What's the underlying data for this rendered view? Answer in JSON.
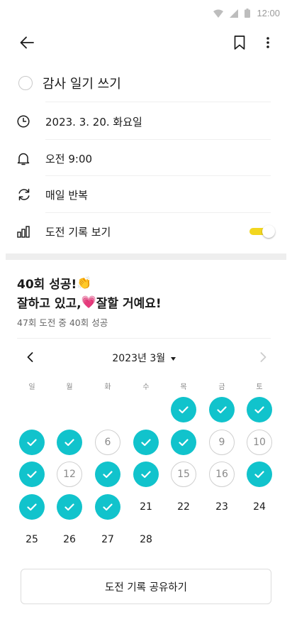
{
  "status_bar": {
    "time": "12:00"
  },
  "task": {
    "title": "감사 일기 쓰기"
  },
  "details": [
    {
      "icon": "clock-icon",
      "label": "2023. 3. 20. 화요일"
    },
    {
      "icon": "bell-icon",
      "label": "오전 9:00"
    },
    {
      "icon": "repeat-icon",
      "label": "매일 반복"
    },
    {
      "icon": "bar-chart-icon",
      "label": "도전 기록 보기"
    }
  ],
  "toggle": {
    "state": "on",
    "accent": "#f2d61f"
  },
  "summary": {
    "line1": "40회 성공!",
    "line1_emoji": "👏",
    "line2a": "잘하고 있고,",
    "line2_emoji": "💗",
    "line2b": " 잘할 거예요!",
    "sub": "47회 도전 중 40회 성공"
  },
  "calendar": {
    "month_label": "2023년 3월",
    "weekdays": [
      "일",
      "월",
      "화",
      "수",
      "목",
      "금",
      "토"
    ],
    "done_color": "#11c3cc",
    "cells": [
      {
        "col": 4,
        "row": 0,
        "day": "",
        "state": "done"
      },
      {
        "col": 5,
        "row": 0,
        "day": "",
        "state": "done"
      },
      {
        "col": 6,
        "row": 0,
        "day": "",
        "state": "done"
      },
      {
        "col": 0,
        "row": 1,
        "day": "",
        "state": "done"
      },
      {
        "col": 1,
        "row": 1,
        "day": "",
        "state": "done"
      },
      {
        "col": 2,
        "row": 1,
        "day": "6",
        "state": "missed"
      },
      {
        "col": 3,
        "row": 1,
        "day": "",
        "state": "done"
      },
      {
        "col": 4,
        "row": 1,
        "day": "",
        "state": "done"
      },
      {
        "col": 5,
        "row": 1,
        "day": "9",
        "state": "missed"
      },
      {
        "col": 6,
        "row": 1,
        "day": "10",
        "state": "missed"
      },
      {
        "col": 0,
        "row": 2,
        "day": "",
        "state": "done"
      },
      {
        "col": 1,
        "row": 2,
        "day": "12",
        "state": "missed"
      },
      {
        "col": 2,
        "row": 2,
        "day": "",
        "state": "done"
      },
      {
        "col": 3,
        "row": 2,
        "day": "",
        "state": "done"
      },
      {
        "col": 4,
        "row": 2,
        "day": "15",
        "state": "missed"
      },
      {
        "col": 5,
        "row": 2,
        "day": "16",
        "state": "missed"
      },
      {
        "col": 6,
        "row": 2,
        "day": "",
        "state": "done"
      },
      {
        "col": 0,
        "row": 3,
        "day": "",
        "state": "done"
      },
      {
        "col": 1,
        "row": 3,
        "day": "",
        "state": "done"
      },
      {
        "col": 2,
        "row": 3,
        "day": "",
        "state": "done"
      },
      {
        "col": 3,
        "row": 3,
        "day": "21",
        "state": "future"
      },
      {
        "col": 4,
        "row": 3,
        "day": "22",
        "state": "future"
      },
      {
        "col": 5,
        "row": 3,
        "day": "23",
        "state": "future"
      },
      {
        "col": 6,
        "row": 3,
        "day": "24",
        "state": "future"
      },
      {
        "col": 0,
        "row": 4,
        "day": "25",
        "state": "future"
      },
      {
        "col": 1,
        "row": 4,
        "day": "26",
        "state": "future"
      },
      {
        "col": 2,
        "row": 4,
        "day": "27",
        "state": "future"
      },
      {
        "col": 3,
        "row": 4,
        "day": "28",
        "state": "future"
      }
    ]
  },
  "share_button": {
    "label": "도전 기록 공유하기"
  }
}
